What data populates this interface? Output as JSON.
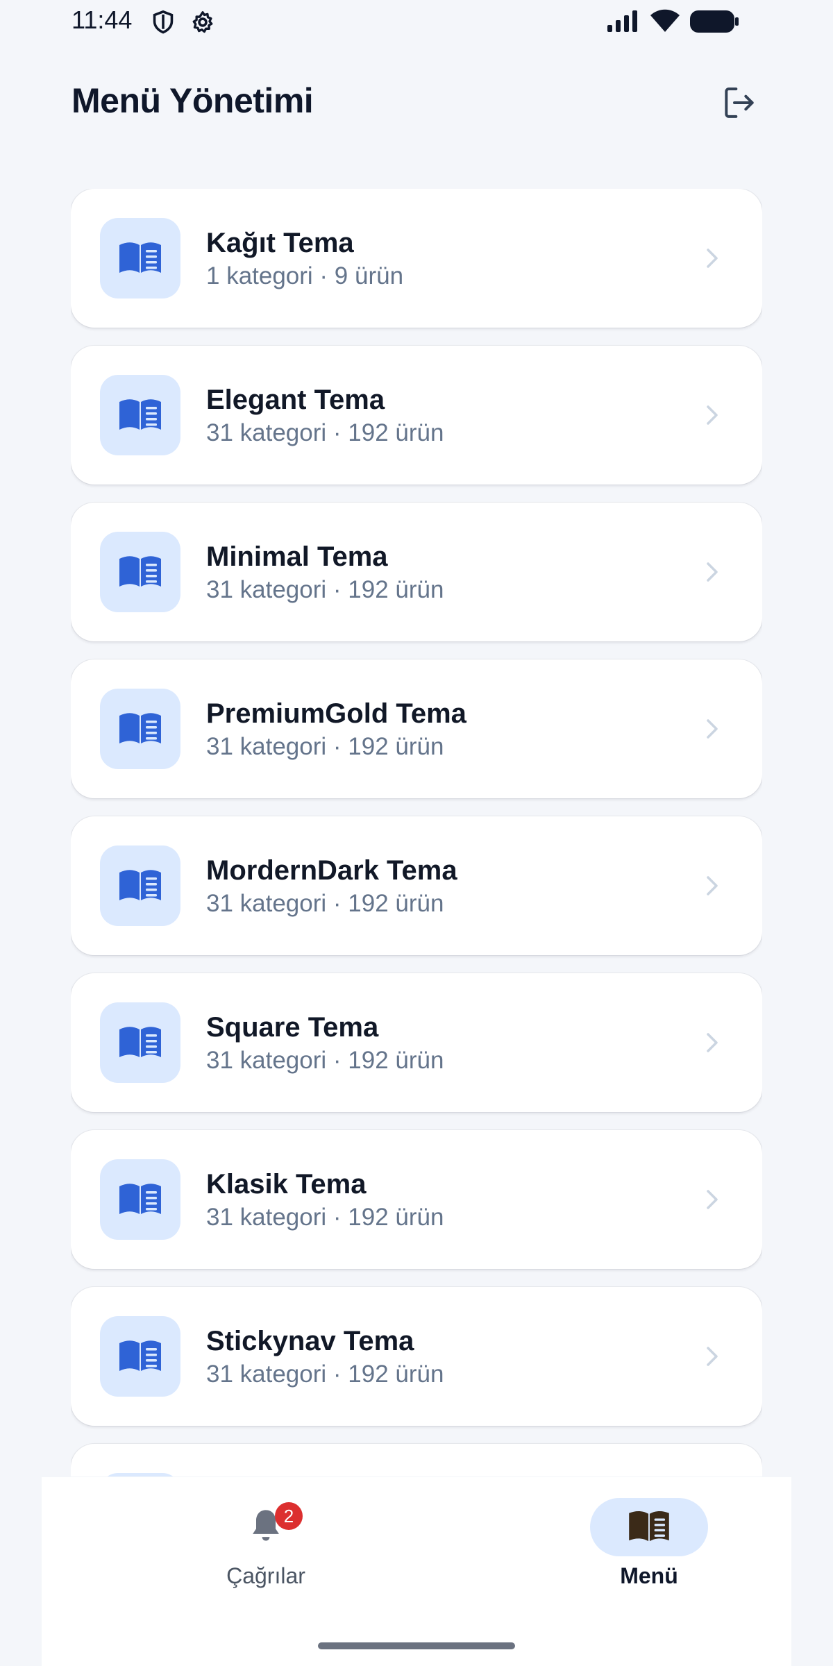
{
  "status_bar": {
    "time": "11:44",
    "left_icons": [
      "shield-icon",
      "gear-icon"
    ],
    "right_icons": [
      "signal-icon",
      "wifi-icon",
      "battery-icon"
    ]
  },
  "header": {
    "title": "Menü Yönetimi",
    "action_icon": "logout-icon"
  },
  "menus": [
    {
      "title": "Kağıt Tema",
      "subtitle": "1 kategori · 9 ürün",
      "icon": "book-icon"
    },
    {
      "title": "Elegant Tema",
      "subtitle": "31 kategori · 192 ürün",
      "icon": "book-icon"
    },
    {
      "title": "Minimal Tema",
      "subtitle": "31 kategori · 192 ürün",
      "icon": "book-icon"
    },
    {
      "title": "PremiumGold Tema",
      "subtitle": "31 kategori · 192 ürün",
      "icon": "book-icon"
    },
    {
      "title": "MordernDark Tema",
      "subtitle": "31 kategori · 192 ürün",
      "icon": "book-icon"
    },
    {
      "title": "Square Tema",
      "subtitle": "31 kategori · 192 ürün",
      "icon": "book-icon"
    },
    {
      "title": "Klasik Tema",
      "subtitle": "31 kategori · 192 ürün",
      "icon": "book-icon"
    },
    {
      "title": "Stickynav Tema",
      "subtitle": "31 kategori · 192 ürün",
      "icon": "book-icon"
    },
    {
      "title": "",
      "subtitle": "",
      "icon": "book-icon"
    }
  ],
  "bottom_nav": {
    "items": [
      {
        "label": "Çağrılar",
        "icon": "bell-icon",
        "badge": "2",
        "active": false
      },
      {
        "label": "Menü",
        "icon": "menu-book-icon",
        "active": true
      }
    ]
  },
  "colors": {
    "background": "#f4f6fa",
    "accent": "#2f63d6",
    "icon_box": "#dbe9fe",
    "badge": "#dc2f2f"
  }
}
